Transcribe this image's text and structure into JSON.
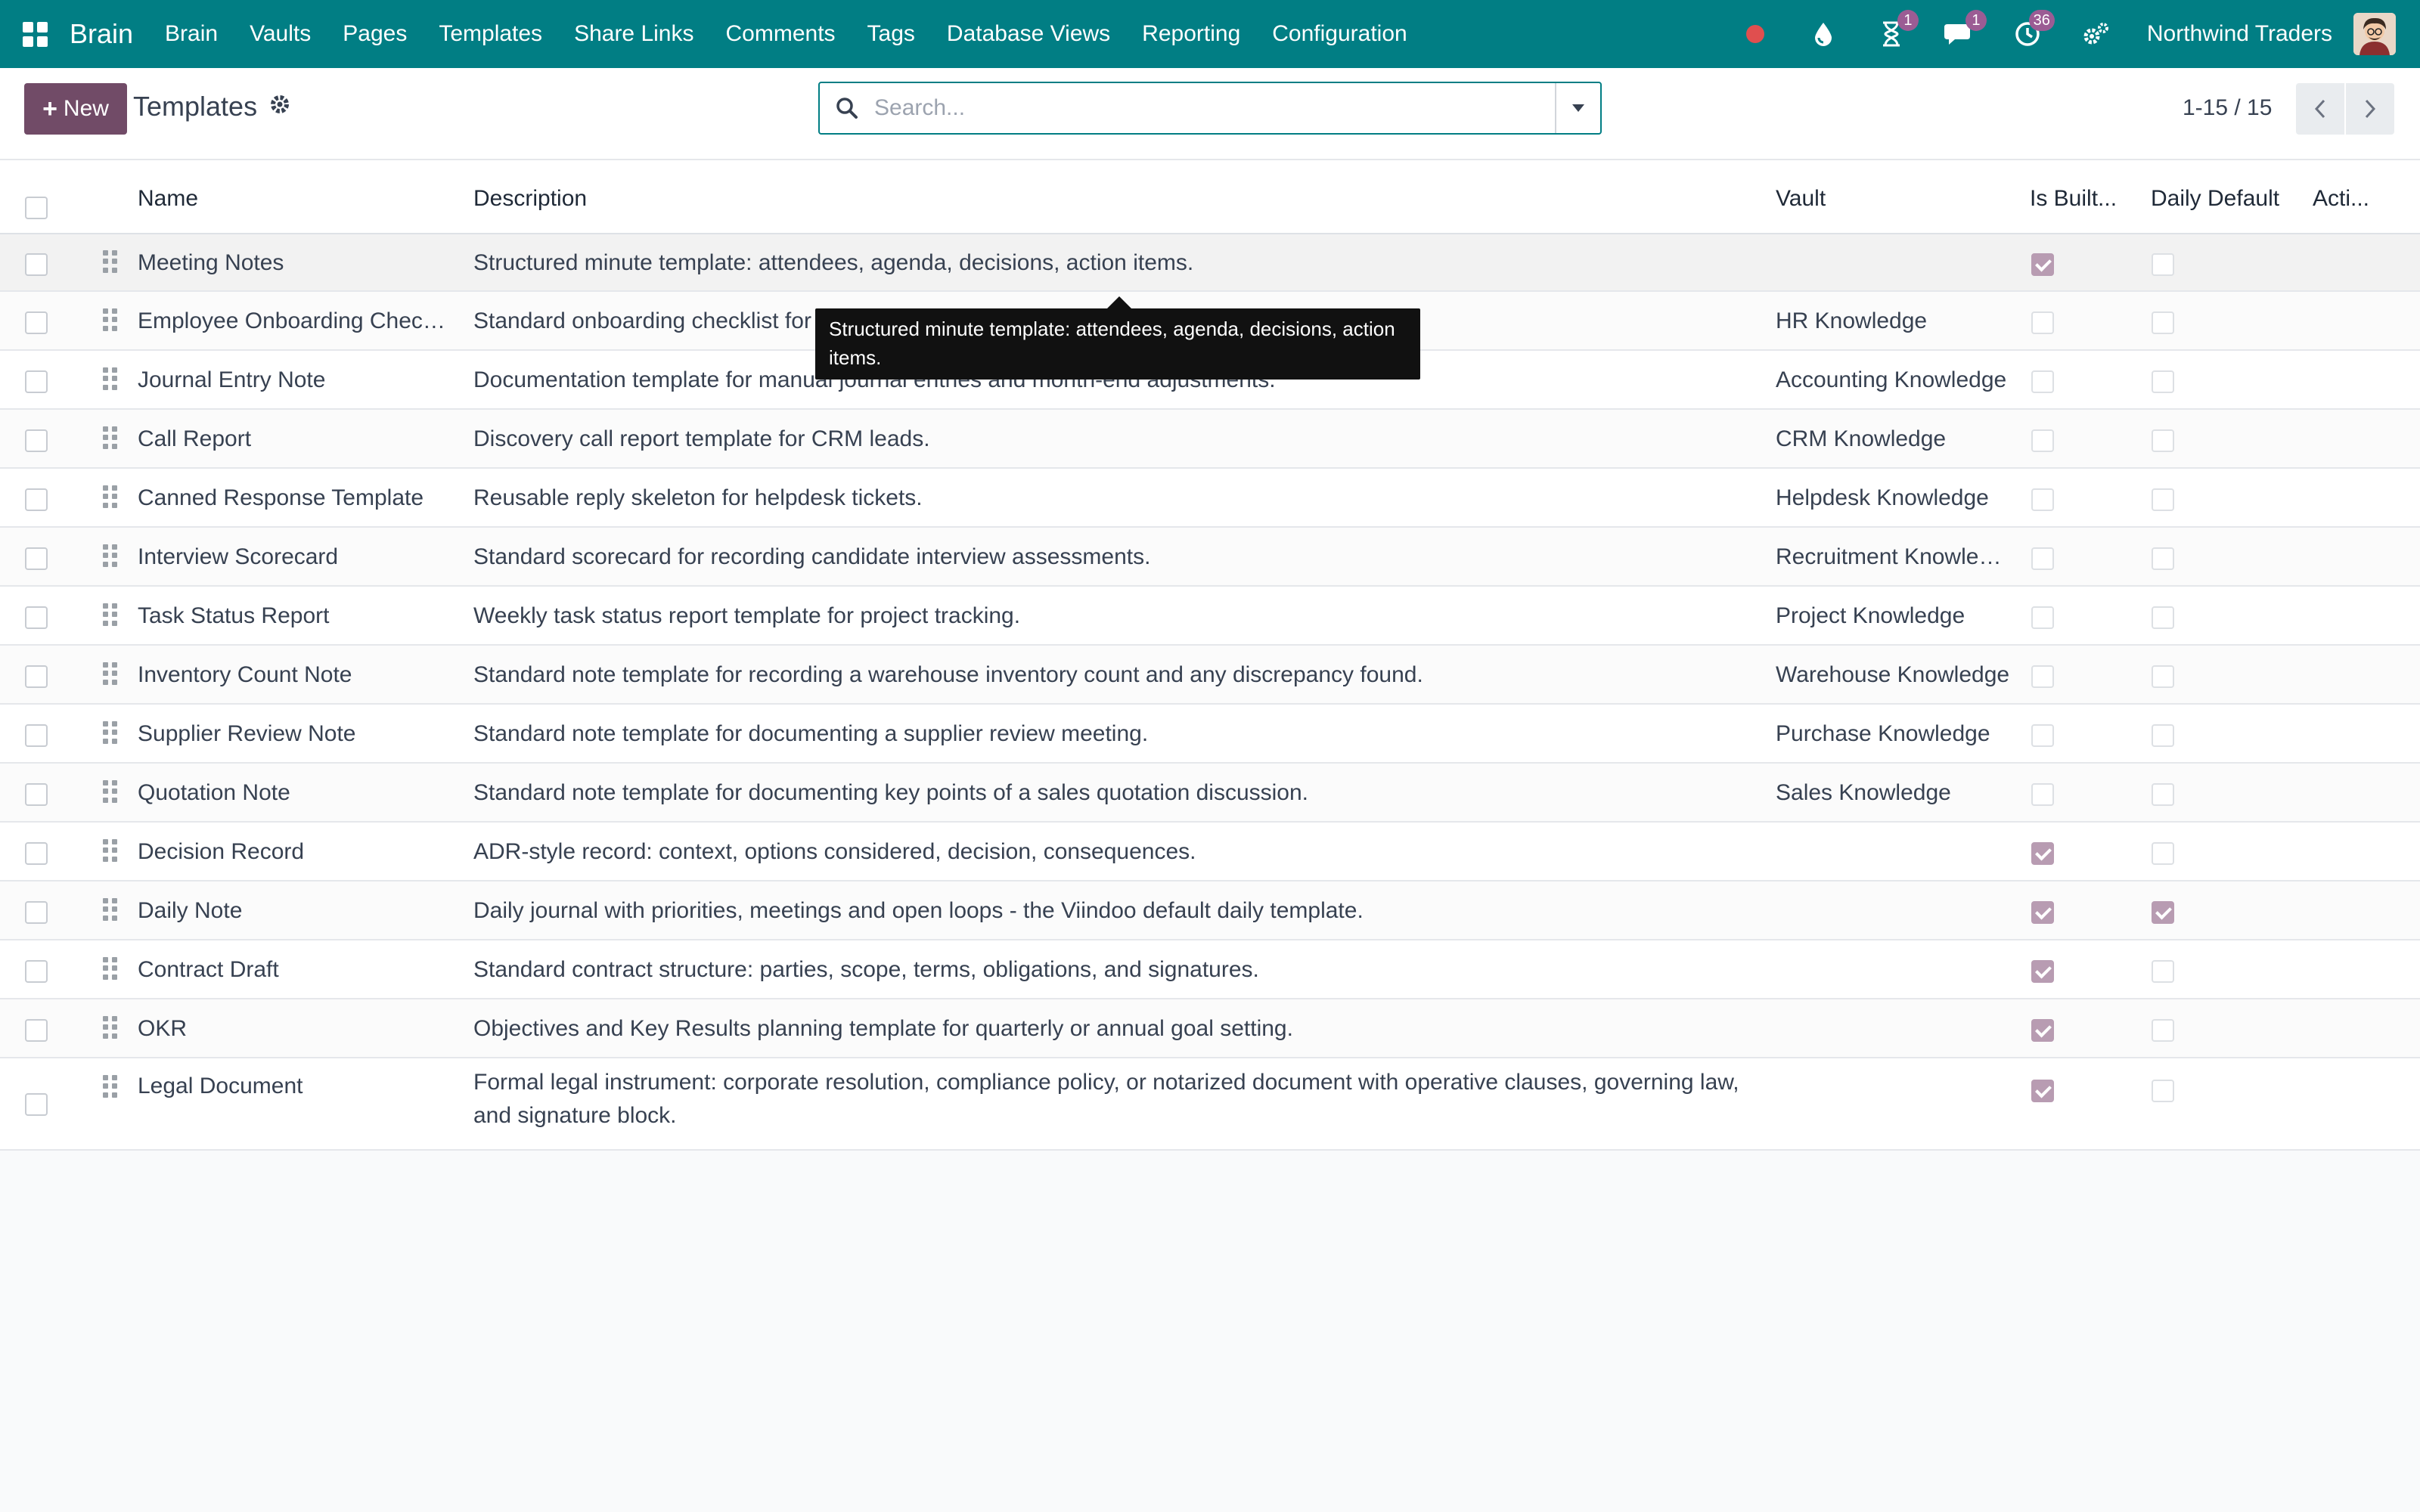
{
  "navbar": {
    "brand": "Brain",
    "menu": [
      "Brain",
      "Vaults",
      "Pages",
      "Templates",
      "Share Links",
      "Comments",
      "Tags",
      "Database Views",
      "Reporting",
      "Configuration"
    ],
    "activity_badge": "1",
    "messages_badge": "1",
    "clock_badge": "36",
    "company": "Northwind Traders",
    "icons": [
      "apps-grid-icon",
      "recording-dot-icon",
      "drop-icon",
      "hourglass-icon",
      "chat-icon",
      "clock-icon",
      "settings-gears-icon"
    ],
    "accent": "#017e84"
  },
  "control_panel": {
    "new_label": "New",
    "title": "Templates",
    "search_placeholder": "Search...",
    "pager": "1-15 / 15",
    "primary_color": "#714b67"
  },
  "table": {
    "headers": {
      "name": "Name",
      "description": "Description",
      "vault": "Vault",
      "is_builtin": "Is Built...",
      "daily_default": "Daily Default",
      "actions": "Acti..."
    },
    "rows": [
      {
        "name": "Meeting Notes",
        "description": "Structured minute template: attendees, agenda, decisions, action items.",
        "vault": "",
        "is_builtin": true,
        "daily_default": false
      },
      {
        "name": "Employee Onboarding Checkli...",
        "description": "Standard onboarding checklist for",
        "vault": "HR Knowledge",
        "is_builtin": false,
        "daily_default": false
      },
      {
        "name": "Journal Entry Note",
        "description": "Documentation template for manual journal entries and month-end adjustments.",
        "vault": "Accounting Knowledge",
        "is_builtin": false,
        "daily_default": false
      },
      {
        "name": "Call Report",
        "description": "Discovery call report template for CRM leads.",
        "vault": "CRM Knowledge",
        "is_builtin": false,
        "daily_default": false
      },
      {
        "name": "Canned Response Template",
        "description": "Reusable reply skeleton for helpdesk tickets.",
        "vault": "Helpdesk Knowledge",
        "is_builtin": false,
        "daily_default": false
      },
      {
        "name": "Interview Scorecard",
        "description": "Standard scorecard for recording candidate interview assessments.",
        "vault": "Recruitment Knowled...",
        "is_builtin": false,
        "daily_default": false
      },
      {
        "name": "Task Status Report",
        "description": "Weekly task status report template for project tracking.",
        "vault": "Project Knowledge",
        "is_builtin": false,
        "daily_default": false
      },
      {
        "name": "Inventory Count Note",
        "description": "Standard note template for recording a warehouse inventory count and any discrepancy found.",
        "vault": "Warehouse Knowledge",
        "is_builtin": false,
        "daily_default": false
      },
      {
        "name": "Supplier Review Note",
        "description": "Standard note template for documenting a supplier review meeting.",
        "vault": "Purchase Knowledge",
        "is_builtin": false,
        "daily_default": false
      },
      {
        "name": "Quotation Note",
        "description": "Standard note template for documenting key points of a sales quotation discussion.",
        "vault": "Sales Knowledge",
        "is_builtin": false,
        "daily_default": false
      },
      {
        "name": "Decision Record",
        "description": "ADR-style record: context, options considered, decision, consequences.",
        "vault": "",
        "is_builtin": true,
        "daily_default": false
      },
      {
        "name": "Daily Note",
        "description": "Daily journal with priorities, meetings and open loops - the Viindoo default daily template.",
        "vault": "",
        "is_builtin": true,
        "daily_default": true
      },
      {
        "name": "Contract Draft",
        "description": "Standard contract structure: parties, scope, terms, obligations, and signatures.",
        "vault": "",
        "is_builtin": true,
        "daily_default": false
      },
      {
        "name": "OKR",
        "description": "Objectives and Key Results planning template for quarterly or annual goal setting.",
        "vault": "",
        "is_builtin": true,
        "daily_default": false
      },
      {
        "name": "Legal Document",
        "description": "Formal legal instrument: corporate resolution, compliance policy, or notarized document with operative clauses, governing law, and signature block.",
        "vault": "",
        "is_builtin": true,
        "daily_default": false
      }
    ]
  },
  "tooltip": {
    "text": "Structured minute template: attendees, agenda, decisions, action items."
  }
}
